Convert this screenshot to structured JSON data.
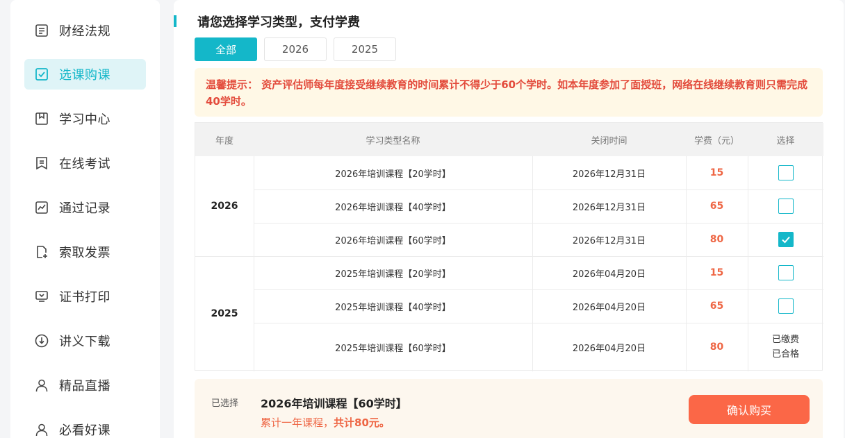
{
  "sidebar": {
    "items": [
      {
        "label": "财经法规",
        "icon": "document-icon"
      },
      {
        "label": "选课购课",
        "icon": "checkbox-icon"
      },
      {
        "label": "学习中心",
        "icon": "bookmark-icon"
      },
      {
        "label": "在线考试",
        "icon": "exam-icon"
      },
      {
        "label": "通过记录",
        "icon": "chart-icon"
      },
      {
        "label": "索取发票",
        "icon": "file-add-icon"
      },
      {
        "label": "证书打印",
        "icon": "monitor-icon"
      },
      {
        "label": "讲义下载",
        "icon": "download-icon"
      },
      {
        "label": "精品直播",
        "icon": "user-icon"
      },
      {
        "label": "必看好课",
        "icon": "user-icon"
      }
    ]
  },
  "main": {
    "title": "请您选择学习类型，支付学费",
    "tabs": [
      {
        "label": "全部"
      },
      {
        "label": "2026"
      },
      {
        "label": "2025"
      }
    ],
    "notice": "温馨提示： 资产评估师每年度接受继续教育的时间累计不得少于60个学时。如本年度参加了面授班，网络在线继续教育则只需完成40学时。"
  },
  "table": {
    "headers": [
      "年度",
      "学习类型名称",
      "关闭时间",
      "学费（元）",
      "选择"
    ],
    "groups": [
      {
        "year": "2026",
        "rows": [
          {
            "name": "2026年培训课程【20学时】",
            "close": "2026年12月31日",
            "fee": "15",
            "checked": false
          },
          {
            "name": "2026年培训课程【40学时】",
            "close": "2026年12月31日",
            "fee": "65",
            "checked": false
          },
          {
            "name": "2026年培训课程【60学时】",
            "close": "2026年12月31日",
            "fee": "80",
            "checked": true
          }
        ]
      },
      {
        "year": "2025",
        "rows": [
          {
            "name": "2025年培训课程【20学时】",
            "close": "2026年04月20日",
            "fee": "15",
            "checked": false
          },
          {
            "name": "2025年培训课程【40学时】",
            "close": "2026年04月20日",
            "fee": "65",
            "checked": false
          },
          {
            "name": "2025年培训课程【60学时】",
            "close": "2026年04月20日",
            "fee": "80",
            "status": [
              "已缴费",
              "已合格"
            ]
          }
        ]
      }
    ]
  },
  "summary": {
    "label": "已选择",
    "course": "2026年培训课程【60学时】",
    "total_prefix": "累计一年课程，",
    "total_amount": "共计80元。",
    "buy_button": "确认购买"
  },
  "colors": {
    "accent": "#14b7c9",
    "fee": "#ee6644",
    "buy": "#fb6747",
    "notice_text": "#e34b3c",
    "notice_bg": "#fff8e6"
  }
}
